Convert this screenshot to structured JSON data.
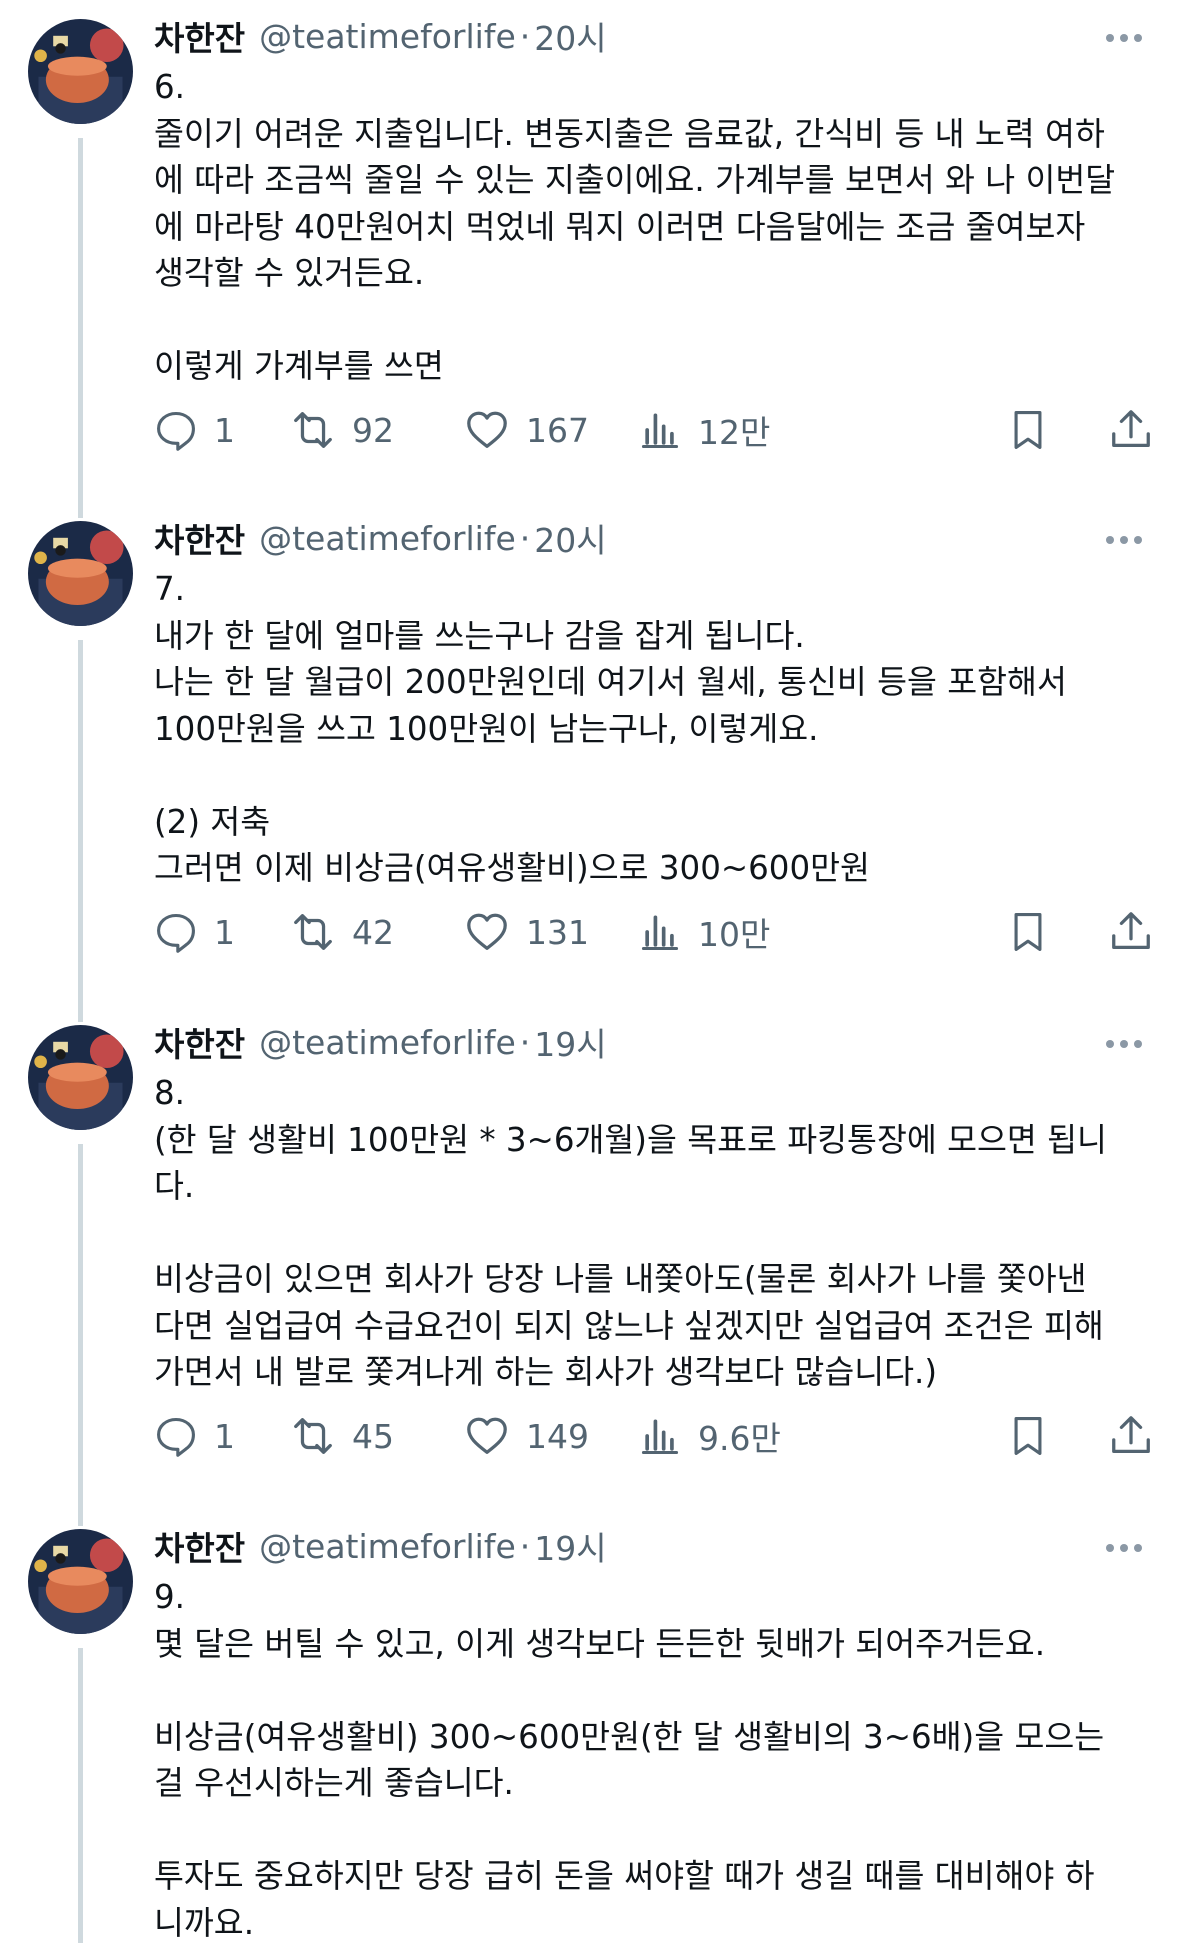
{
  "tweets": [
    {
      "author_name": "차한잔",
      "handle": "@teatimeforlife",
      "separator": "·",
      "time": "20시",
      "body": "6.\n줄이기 어려운 지출입니다. 변동지출은 음료값, 간식비 등 내 노력 여하\n에 따라 조금씩 줄일 수 있는 지출이에요. 가계부를 보면서 와 나 이번달\n에 마라탕 40만원어치 먹었네 뭐지 이러면 다음달에는 조금 줄여보자\n생각할 수 있거든요.\n\n이렇게 가계부를 쓰면",
      "replies": "1",
      "retweets": "92",
      "likes": "167",
      "views": "12만"
    },
    {
      "author_name": "차한잔",
      "handle": "@teatimeforlife",
      "separator": "·",
      "time": "20시",
      "body": "7.\n내가 한 달에 얼마를 쓰는구나 감을 잡게 됩니다.\n나는 한 달 월급이 200만원인데 여기서 월세, 통신비 등을 포함해서\n100만원을 쓰고 100만원이 남는구나, 이렇게요.\n\n(2) 저축\n그러면 이제 비상금(여유생활비)으로 300~600만원",
      "replies": "1",
      "retweets": "42",
      "likes": "131",
      "views": "10만"
    },
    {
      "author_name": "차한잔",
      "handle": "@teatimeforlife",
      "separator": "·",
      "time": "19시",
      "body": "8.\n(한 달 생활비 100만원 * 3~6개월)을 목표로 파킹통장에 모으면 됩니\n다.\n\n비상금이 있으면 회사가 당장 나를 내쫓아도(물론 회사가 나를 쫓아낸\n다면 실업급여 수급요건이 되지 않느냐 싶겠지만 실업급여 조건은 피해\n가면서 내 발로 쫓겨나게 하는 회사가 생각보다 많습니다.)",
      "replies": "1",
      "retweets": "45",
      "likes": "149",
      "views": "9.6만"
    },
    {
      "author_name": "차한잔",
      "handle": "@teatimeforlife",
      "separator": "·",
      "time": "19시",
      "body": "9.\n몇 달은 버틸 수 있고, 이게 생각보다 든든한 뒷배가 되어주거든요.\n\n비상금(여유생활비) 300~600만원(한 달 생활비의 3~6배)을 모으는\n걸 우선시하는게 좋습니다.\n\n투자도 중요하지만 당장 급히 돈을 써야할 때가 생길 때를 대비해야 하\n니까요."
    }
  ],
  "icons": {
    "reply": "reply-icon",
    "retweet": "retweet-icon",
    "like": "heart-icon",
    "views": "views-icon",
    "bookmark": "bookmark-icon",
    "share": "share-icon",
    "more": "more-icon"
  },
  "colors": {
    "text": "#0f1419",
    "secondary": "#536471",
    "thread_line": "#cfd9de",
    "background": "#ffffff"
  }
}
